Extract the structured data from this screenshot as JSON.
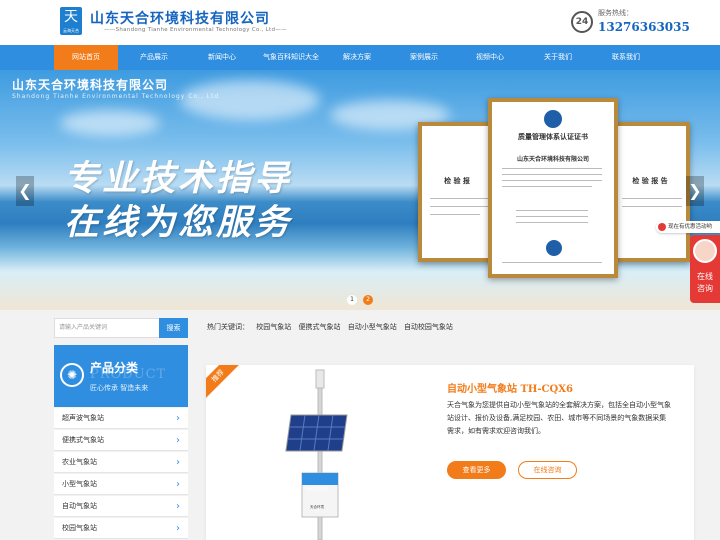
{
  "header": {
    "logo_glyph": "天",
    "logo_sub": "云海天合",
    "company_name": "山东天合环境科技有限公司",
    "company_en": "——Shandong Tianhe Environmental Technology Co., Ltd——",
    "hotline_badge": "24",
    "hotline_label": "服务热线：",
    "hotline_number": "13276363035"
  },
  "nav": {
    "items": [
      {
        "label": "网站首页",
        "active": true
      },
      {
        "label": "产品展示"
      },
      {
        "label": "新闻中心"
      },
      {
        "label": "气象百科知识大全"
      },
      {
        "label": "解决方案"
      },
      {
        "label": "案例展示"
      },
      {
        "label": "视频中心"
      },
      {
        "label": "关于我们"
      },
      {
        "label": "联系我们"
      }
    ]
  },
  "banner": {
    "company_name": "山东天合环境科技有限公司",
    "company_en": "Shandong Tianhe Environmental Technology Co., Ltd",
    "slogan_line1": "专业技术指导",
    "slogan_line2": "在线为您服务",
    "cert_left_title": "检 验 报",
    "cert_center_title": "质量管理体系认证证书",
    "cert_center_company": "山东天合环境科技有限公司",
    "cert_right_title": "检 验 报 告",
    "prev_arrow": "❮",
    "next_arrow": "❯",
    "dots": [
      "1",
      "2"
    ]
  },
  "float": {
    "chat_label": "现在有优惠活动哟",
    "service_text_1": "在线",
    "service_text_2": "咨询"
  },
  "search": {
    "placeholder": "请输入产品关键词",
    "button": "搜索"
  },
  "hot_keywords": {
    "label": "热门关键词：",
    "items": [
      "校园气象站",
      "便携式气象站",
      "自动小型气象站",
      "自动校园气象站"
    ]
  },
  "category": {
    "title": "产品分类",
    "watermark": "PRODUCT",
    "subtitle": "匠心传承 智造未来",
    "icon_glyph": "✺",
    "items": [
      "超声波气象站",
      "便携式气象站",
      "农业气象站",
      "小型气象站",
      "自动气象站",
      "校园气象站"
    ]
  },
  "product": {
    "tag": "推荐",
    "title": "自动小型气象站 TH-CQX6",
    "description": "天合气象为您提供自动小型气象站的全套解决方案，包括全自动小型气象站设计、报价及设备,满足校园、农田、城市等不同场景的气象数据采集需求，如有需求欢迎咨询我们。",
    "btn_more": "查看更多",
    "btn_consult": "在线咨询",
    "device_label": "气象环境监测站",
    "device_brand": "天合环境"
  },
  "colors": {
    "primary_blue": "#2f8ee0",
    "accent_orange": "#f27c1a",
    "service_red": "#e53935"
  }
}
